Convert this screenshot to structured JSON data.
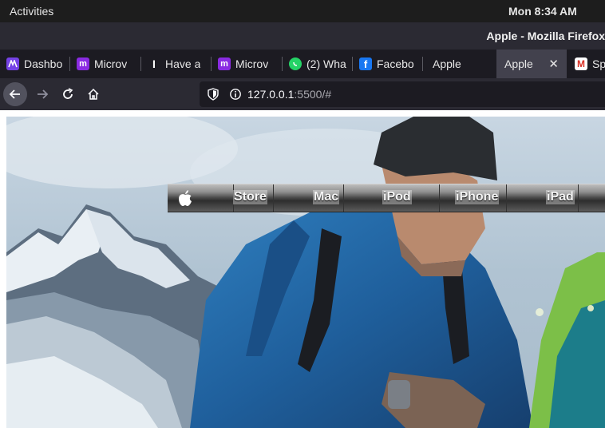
{
  "system_bar": {
    "activities": "Activities",
    "clock": "Mon  8:34 AM"
  },
  "window": {
    "title": "Apple - Mozilla Firefox"
  },
  "tabs": [
    {
      "label": "Dashbo",
      "icon": "dashboard-favicon-icon",
      "color": "#7542e5"
    },
    {
      "label": "Microv",
      "icon": "m-favicon-icon",
      "color": "#8a2be2"
    },
    {
      "label": "Have a",
      "icon": "cursor-favicon-icon",
      "color": "#111111"
    },
    {
      "label": "Microv",
      "icon": "m-favicon-icon",
      "color": "#8a2be2"
    },
    {
      "label": "(2) Wha",
      "icon": "whatsapp-icon",
      "color": "#25d366"
    },
    {
      "label": "Facebo",
      "icon": "facebook-icon",
      "color": "#1877f2"
    },
    {
      "label": "Apple",
      "icon": "",
      "color": ""
    },
    {
      "label": "Apple",
      "icon": "",
      "color": ""
    },
    {
      "label": "Sp",
      "icon": "gmail-icon",
      "color": "#d93025"
    }
  ],
  "active_tab_index": 7,
  "navbar": {
    "url_host": "127.0.0.1",
    "url_rest": ":5500/#"
  },
  "page": {
    "menu": [
      {
        "label": "",
        "icon": "apple-logo-icon"
      },
      {
        "label": "Store"
      },
      {
        "label": "Mac"
      },
      {
        "label": "iPod"
      },
      {
        "label": "iPhone"
      },
      {
        "label": "iPad"
      }
    ]
  }
}
